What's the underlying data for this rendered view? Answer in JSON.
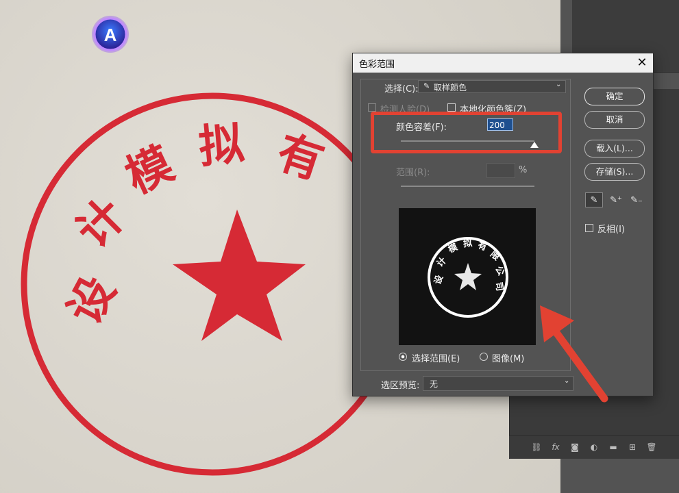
{
  "dialog": {
    "title": "色彩范围",
    "close_glyph": "✕",
    "select_label": "选择(C):",
    "select_value": "取样颜色",
    "detect_faces_label": "检测人脸(D)",
    "localized_clusters_label": "本地化颜色簇(Z)",
    "fuzziness_label": "颜色容差(F):",
    "fuzziness_value": "200",
    "range_label": "范围(R):",
    "range_unit": "%",
    "radio_selection": "选择范围(E)",
    "radio_image": "图像(M)",
    "preview_label": "选区预览:",
    "preview_value": "无",
    "buttons": {
      "ok": "确定",
      "cancel": "取消",
      "load": "载入(L)...",
      "save": "存储(S)..."
    },
    "invert_label": "反相(I)",
    "tools": [
      "eyedropper-icon",
      "eyedropper-plus-icon",
      "eyedropper-minus-icon"
    ]
  },
  "stamp": {
    "text": "设计模拟有限公司",
    "color": "#d62a35"
  },
  "colors": {
    "highlight": "#e24232",
    "dialog_bg": "#535353"
  },
  "layers_panel": {
    "footer_icons": [
      "link-icon",
      "fx-icon",
      "mask-icon",
      "adjustment-icon",
      "folder-icon",
      "new-layer-icon",
      "trash-icon"
    ],
    "fx_label": "fx"
  }
}
